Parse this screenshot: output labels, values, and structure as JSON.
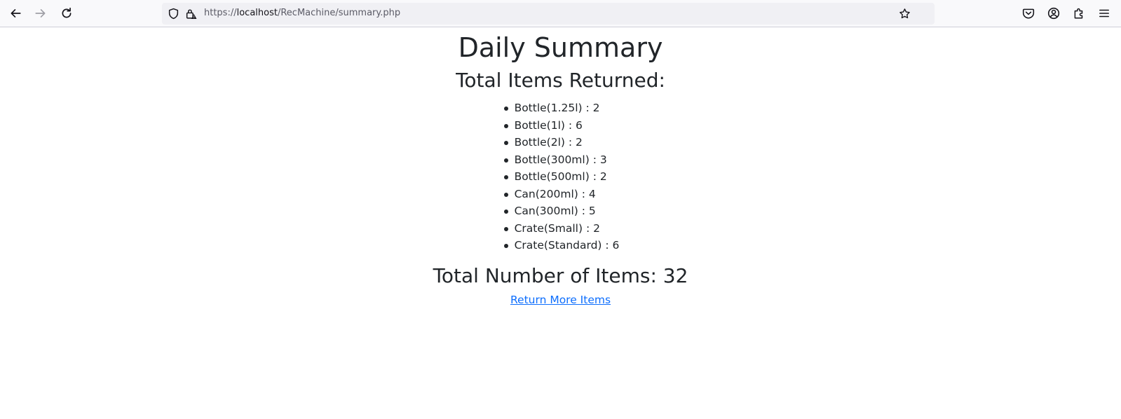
{
  "browser": {
    "url_scheme": "https://",
    "url_host": "localhost",
    "url_path": "/RecMachine/summary.php"
  },
  "page": {
    "title": "Daily Summary",
    "subtitle": "Total Items Returned:",
    "items": [
      {
        "label": "Bottle(1.25l) : 2"
      },
      {
        "label": "Bottle(1l) : 6"
      },
      {
        "label": "Bottle(2l) : 2"
      },
      {
        "label": "Bottle(300ml) : 3"
      },
      {
        "label": "Bottle(500ml) : 2"
      },
      {
        "label": "Can(200ml) : 4"
      },
      {
        "label": "Can(300ml) : 5"
      },
      {
        "label": "Crate(Small) : 2"
      },
      {
        "label": "Crate(Standard) : 6"
      }
    ],
    "total_text": "Total Number of Items: 32",
    "return_link": "Return More Items"
  },
  "colors": {
    "link": "#0d6efd",
    "text": "#212529",
    "toolbar_bg": "#f9f9fb",
    "urlbar_bg": "#f0f0f4"
  }
}
